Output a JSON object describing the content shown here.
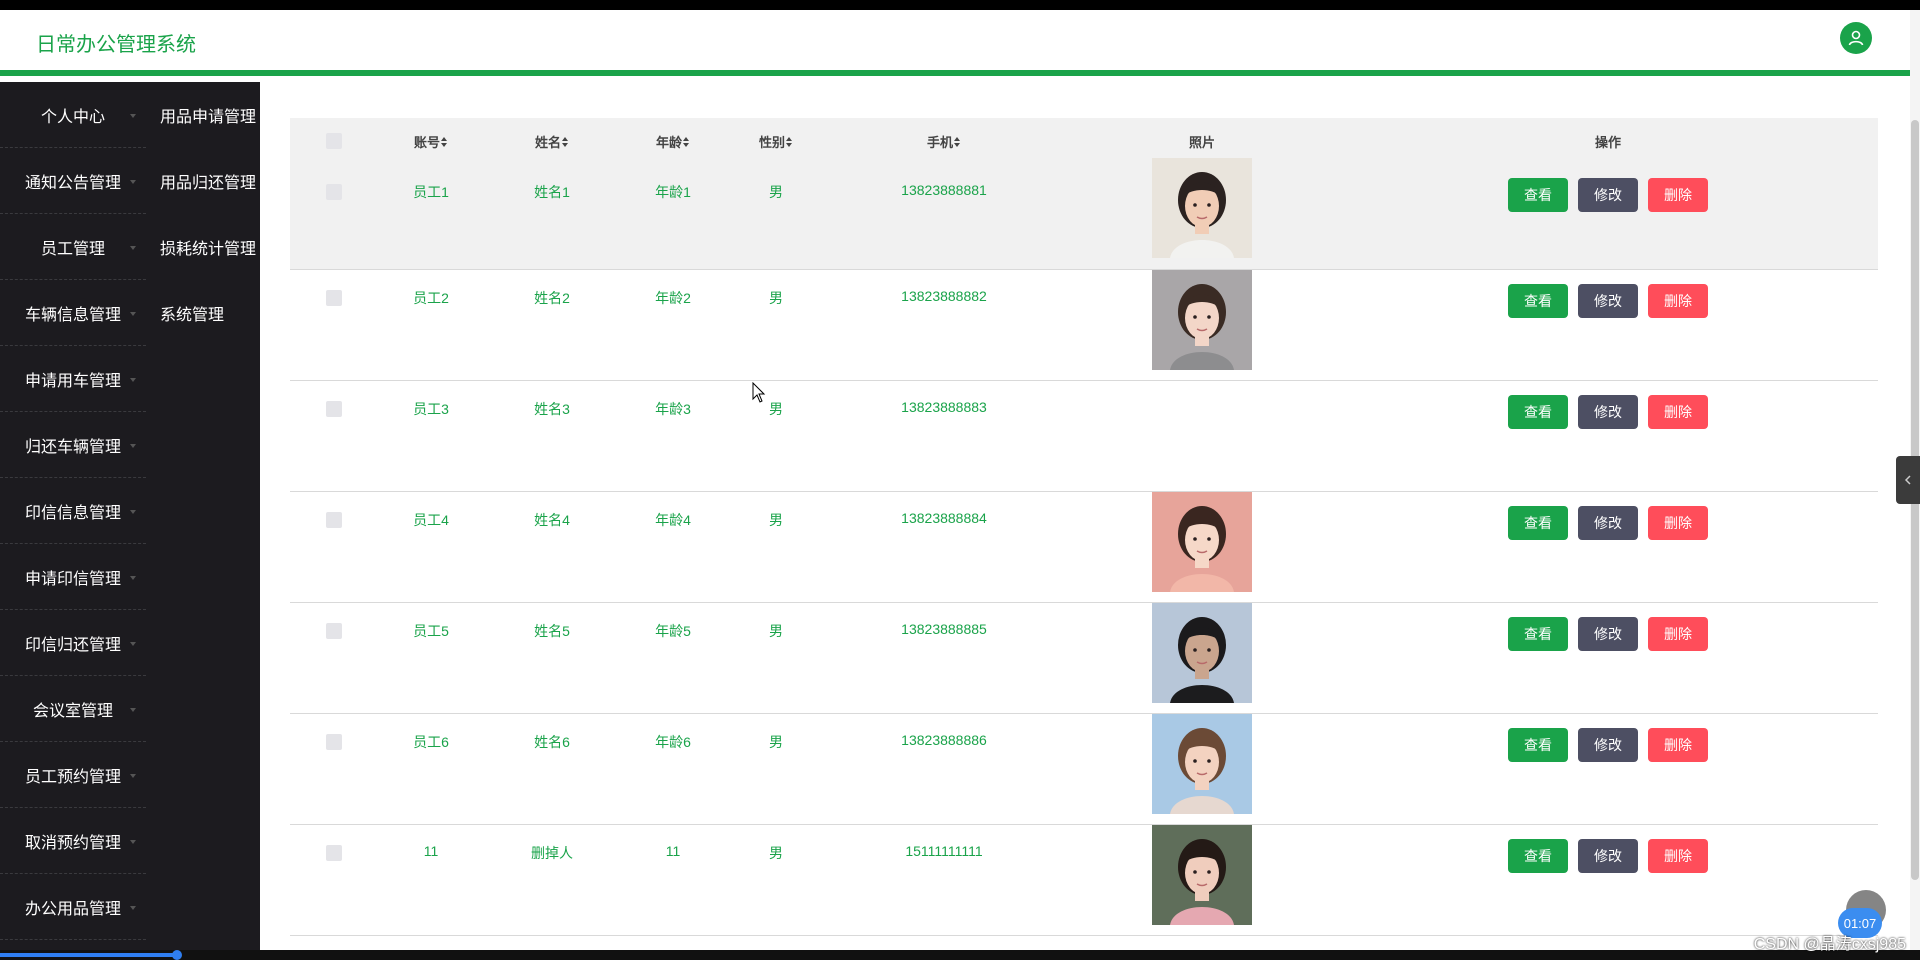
{
  "header": {
    "title": "日常办公管理系统",
    "user_icon": "user-icon",
    "accent": "#1aa34a"
  },
  "sidebar": {
    "col1": [
      "个人中心",
      "通知公告管理",
      "员工管理",
      "车辆信息管理",
      "申请用车管理",
      "归还车辆管理",
      "印信信息管理",
      "申请印信管理",
      "印信归还管理",
      "会议室管理",
      "员工预约管理",
      "取消预约管理",
      "办公用品管理"
    ],
    "col2": [
      "用品申请管理",
      "用品归还管理",
      "损耗统计管理",
      "系统管理"
    ]
  },
  "table": {
    "headers": {
      "account": "账号",
      "name": "姓名",
      "age": "年龄",
      "gender": "性别",
      "phone": "手机",
      "photo": "照片",
      "actions": "操作"
    },
    "buttons": {
      "view": "查看",
      "edit": "修改",
      "delete": "删除"
    },
    "rows": [
      {
        "account": "员工1",
        "name": "姓名1",
        "age": "年龄1",
        "gender": "男",
        "phone": "13823888881"
      },
      {
        "account": "员工2",
        "name": "姓名2",
        "age": "年龄2",
        "gender": "男",
        "phone": "13823888882"
      },
      {
        "account": "员工3",
        "name": "姓名3",
        "age": "年龄3",
        "gender": "男",
        "phone": "13823888883"
      },
      {
        "account": "员工4",
        "name": "姓名4",
        "age": "年龄4",
        "gender": "男",
        "phone": "13823888884"
      },
      {
        "account": "员工5",
        "name": "姓名5",
        "age": "年龄5",
        "gender": "男",
        "phone": "13823888885"
      },
      {
        "account": "员工6",
        "name": "姓名6",
        "age": "年龄6",
        "gender": "男",
        "phone": "13823888886"
      },
      {
        "account": "11",
        "name": "删掉人",
        "age": "11",
        "gender": "男",
        "phone": "15111111111"
      }
    ]
  },
  "overlay": {
    "timer": "01:07",
    "watermark": "CSDN @晶涛cxsj985"
  }
}
